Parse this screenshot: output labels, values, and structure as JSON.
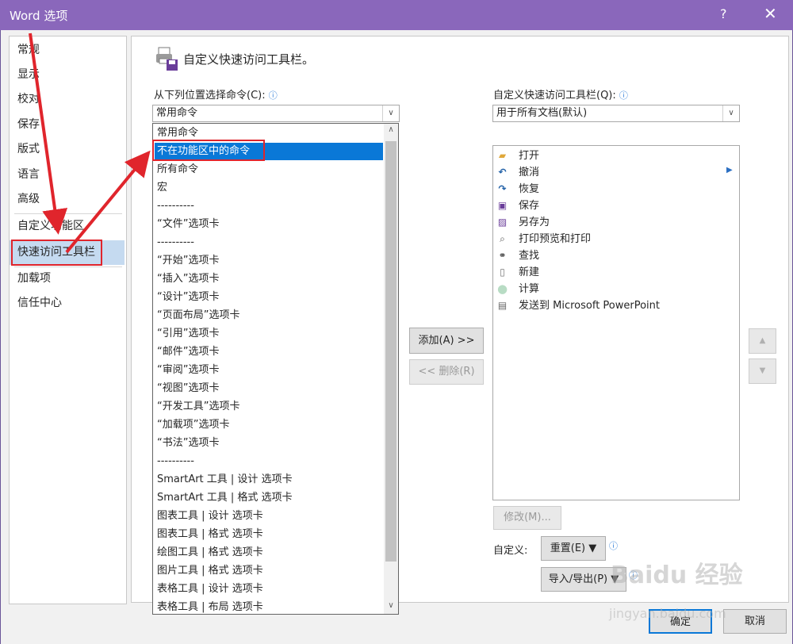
{
  "window": {
    "title": "Word 选项",
    "help": "?",
    "close": "✕"
  },
  "nav": {
    "items": [
      {
        "label": "常规"
      },
      {
        "label": "显示"
      },
      {
        "label": "校对"
      },
      {
        "label": "保存"
      },
      {
        "label": "版式"
      },
      {
        "label": "语言"
      },
      {
        "label": "高级"
      },
      {
        "label": "自定义功能区"
      },
      {
        "label": "快速访问工具栏"
      },
      {
        "label": "加载项"
      },
      {
        "label": "信任中心"
      }
    ],
    "selected": "快速访问工具栏"
  },
  "main": {
    "heading": "自定义快速访问工具栏。",
    "choose_label": "从下列位置选择命令(C):",
    "choose_value": "常用命令",
    "choose_options": [
      "常用命令",
      "不在功能区中的命令",
      "所有命令",
      "宏",
      "----------",
      "“文件”选项卡",
      "----------",
      "“开始”选项卡",
      "“插入”选项卡",
      "“设计”选项卡",
      "“页面布局”选项卡",
      "“引用”选项卡",
      "“邮件”选项卡",
      "“审阅”选项卡",
      "“视图”选项卡",
      "“开发工具”选项卡",
      "“加载项”选项卡",
      "“书法”选项卡",
      "----------",
      "SmartArt 工具 | 设计 选项卡",
      "SmartArt 工具 | 格式 选项卡",
      "图表工具 | 设计 选项卡",
      "图表工具 | 格式 选项卡",
      "绘图工具 | 格式 选项卡",
      "图片工具 | 格式 选项卡",
      "表格工具 | 设计 选项卡",
      "表格工具 | 布局 选项卡"
    ],
    "highlighted_option": "不在功能区中的命令",
    "qat_label": "自定义快速访问工具栏(Q):",
    "qat_value": "用于所有文档(默认)",
    "qat_items": [
      {
        "label": "打开",
        "icon": "folder-open-icon"
      },
      {
        "label": "撤消",
        "icon": "undo-icon"
      },
      {
        "label": "恢复",
        "icon": "redo-icon"
      },
      {
        "label": "保存",
        "icon": "save-icon"
      },
      {
        "label": "另存为",
        "icon": "save-as-icon"
      },
      {
        "label": "打印预览和打印",
        "icon": "print-preview-icon"
      },
      {
        "label": "查找",
        "icon": "binoculars-icon"
      },
      {
        "label": "新建",
        "icon": "new-document-icon"
      },
      {
        "label": "计算",
        "icon": "calculate-icon"
      },
      {
        "label": "发送到 Microsoft PowerPoint",
        "icon": "powerpoint-icon"
      }
    ],
    "add_button": "添加(A) >>",
    "remove_button": "<< 删除(R)",
    "modify_button": "修改(M)...",
    "customize_label": "自定义:",
    "reset_button": "重置(E) ▼",
    "import_export_button": "导入/导出(P) ▼",
    "ok_button": "确定",
    "cancel_button": "取消"
  },
  "colors": {
    "title_bar": "#8a67bb",
    "selection": "#0a78d7",
    "annotation": "#e0252c"
  },
  "watermark": {
    "brand": "Baidu 经验",
    "url": "jingyan.baidu.com"
  }
}
